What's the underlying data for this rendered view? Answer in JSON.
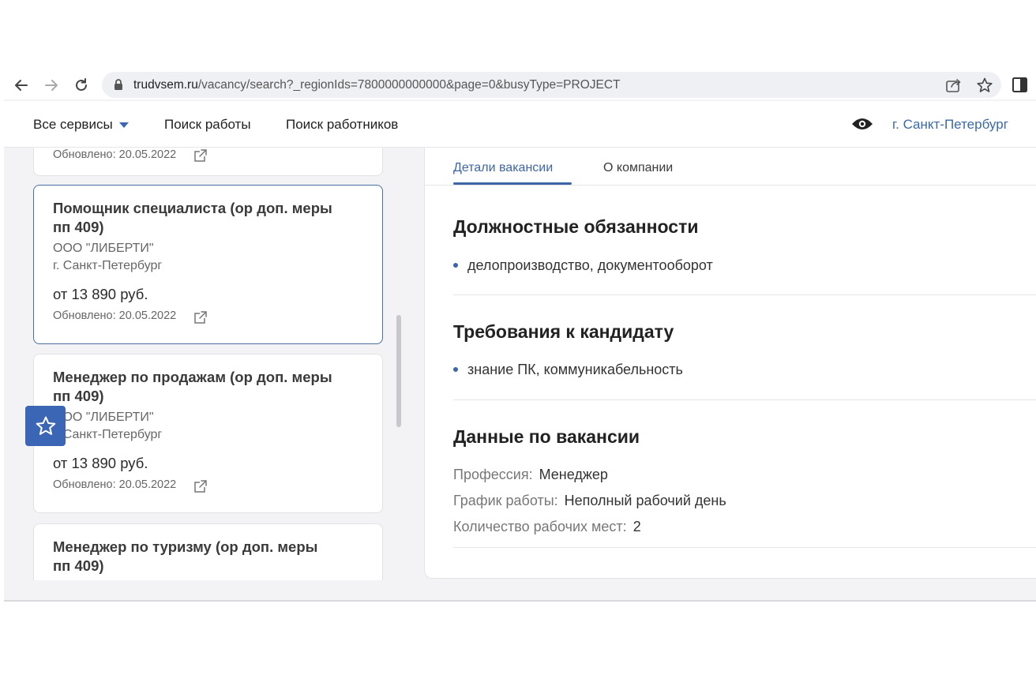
{
  "browser": {
    "url_host": "trudvsem.ru",
    "url_path": "/vacancy/search?_regionIds=7800000000000&page=0&busyType=PROJECT",
    "icons": [
      "back-icon",
      "forward-icon",
      "reload-icon",
      "lock-icon",
      "share-icon",
      "star-icon",
      "side-panel-icon"
    ]
  },
  "header": {
    "services": "Все сервисы",
    "job_search": "Поиск работы",
    "worker_search": "Поиск работников",
    "region": "г. Санкт-Петербург",
    "accent_color": "#3a6aa8"
  },
  "vacancy_list": [
    {
      "title": "",
      "company": "",
      "city": "",
      "salary": "",
      "updated": "Обновлено: 20.05.2022"
    },
    {
      "title": "Помощник специалиста (ор доп. меры пп 409)",
      "company": "ООО \"ЛИБЕРТИ\"",
      "city": "г. Санкт-Петербург",
      "salary": "от 13 890 руб.",
      "updated": "Обновлено: 20.05.2022",
      "selected": true
    },
    {
      "title": "Менеджер по продажам (ор доп. меры пп 409)",
      "company": "ООО \"ЛИБЕРТИ\"",
      "city": "г. Санкт-Петербург",
      "salary": "от 13 890 руб.",
      "updated": "Обновлено: 20.05.2022"
    },
    {
      "title": "Менеджер по туризму (ор доп. меры пп 409)",
      "company": "",
      "city": "",
      "salary": "",
      "updated": ""
    }
  ],
  "details": {
    "tabs": [
      "Детали вакансии",
      "О компании"
    ],
    "duties_title": "Должностные обязанности",
    "duties": [
      "делопроизводство, документооборот"
    ],
    "requirements_title": "Требования к кандидату",
    "requirements": [
      "знание ПК, коммуникабельность"
    ],
    "data_title": "Данные по вакансии",
    "fields": [
      {
        "label": "Профессия:",
        "value": "Менеджер"
      },
      {
        "label": "График работы:",
        "value": "Неполный рабочий день"
      },
      {
        "label": "Количество рабочих мест:",
        "value": "2"
      }
    ]
  },
  "colors": {
    "brand_blue": "#3a66b5",
    "tab_active": "#3e66a6",
    "background": "#f3f3f5"
  }
}
